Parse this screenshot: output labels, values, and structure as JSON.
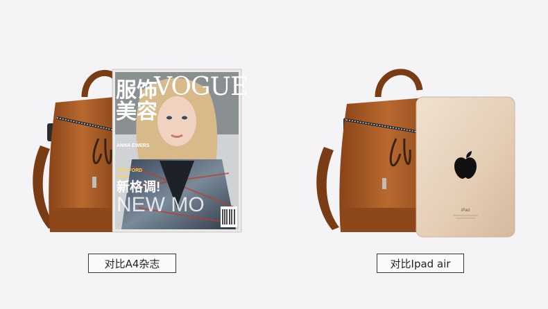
{
  "left_panel": {
    "magazine": {
      "chinese_title": [
        "服饰",
        "美容"
      ],
      "brand": "VOGUE",
      "sidebar_lines": [
        "ANNA EWERS",
        "TOM FORD",
        "RAIN"
      ],
      "headline": "新格调!",
      "cover_line": "NEW MO"
    },
    "caption": "对比A4杂志"
  },
  "right_panel": {
    "tablet": {
      "label": "iPad"
    },
    "caption": "对比Ipad air"
  },
  "colors": {
    "background": "#f4f4f6",
    "leather": "#a65a26",
    "leather_dark": "#6b3514",
    "tablet_gold": "#e6d2bd"
  }
}
